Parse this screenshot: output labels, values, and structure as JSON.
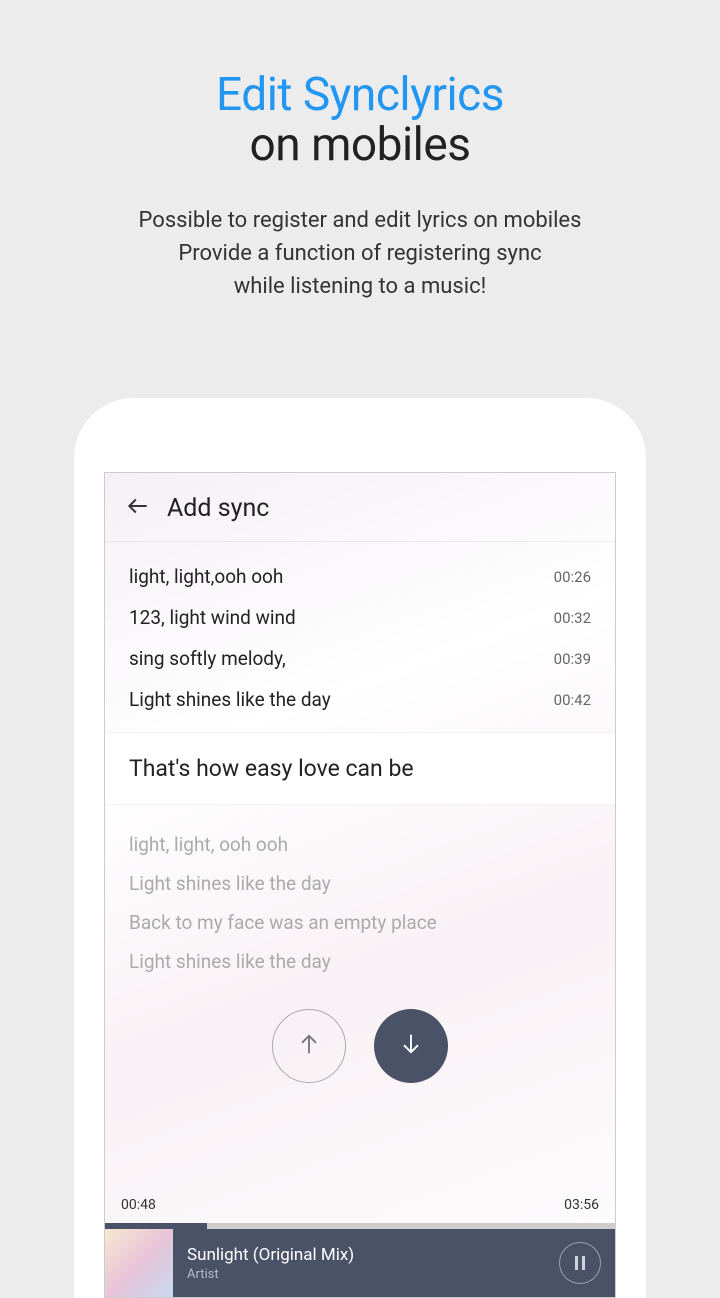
{
  "promo": {
    "title1": "Edit Synclyrics",
    "title2": "on mobiles",
    "sub1": "Possible to register and edit lyrics on mobiles",
    "sub2": "Provide a function of registering sync",
    "sub3": "while listening to a music!"
  },
  "app": {
    "title": "Add sync",
    "synced": [
      {
        "text": "light, light,ooh ooh",
        "time": "00:26"
      },
      {
        "text": "123, light wind wind",
        "time": "00:32"
      },
      {
        "text": "sing softly melody,",
        "time": "00:39"
      },
      {
        "text": "Light shines like the day",
        "time": "00:42"
      }
    ],
    "current": "That's how easy love can be",
    "upcoming": [
      "light, light, ooh ooh",
      "Light shines like the day",
      "Back to my face was an empty place",
      "Light shines like the day"
    ],
    "progress": {
      "elapsed": "00:48",
      "total": "03:56"
    },
    "nowPlaying": {
      "title": "Sunlight (Original Mix)",
      "artist": "Artist"
    }
  }
}
